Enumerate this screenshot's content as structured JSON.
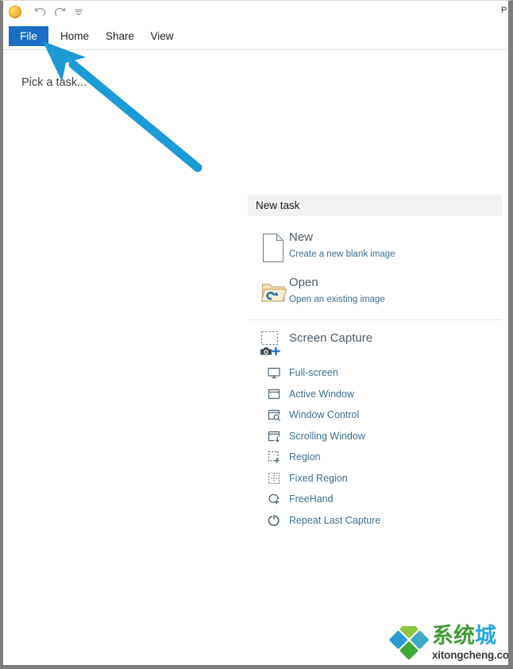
{
  "window": {
    "titlebar": {
      "app_icon": "app-logo-icon",
      "quick_access": [
        {
          "name": "undo-icon",
          "label": "Undo"
        },
        {
          "name": "redo-icon",
          "label": "Redo"
        },
        {
          "name": "customize-quick-access-icon",
          "label": "Customize Quick Access Toolbar"
        }
      ],
      "right_cut_text": "P"
    },
    "ribbon": {
      "tabs": [
        {
          "label": "File",
          "active": true
        },
        {
          "label": "Home",
          "active": false
        },
        {
          "label": "Share",
          "active": false
        },
        {
          "label": "View",
          "active": false
        }
      ]
    },
    "body": {
      "hint": "Pick a task..."
    }
  },
  "task_panel": {
    "header": "New task",
    "items": [
      {
        "icon": "new-document-icon",
        "title": "New",
        "subtitle": "Create a new blank image"
      },
      {
        "icon": "open-folder-icon",
        "title": "Open",
        "subtitle": "Open an existing image"
      }
    ],
    "screen_capture": {
      "icon": "screen-capture-icon",
      "title": "Screen Capture",
      "options": [
        {
          "icon": "monitor-icon",
          "label": "Full-screen"
        },
        {
          "icon": "window-icon",
          "label": "Active Window"
        },
        {
          "icon": "window-search-icon",
          "label": "Window Control"
        },
        {
          "icon": "scroll-window-icon",
          "label": "Scrolling Window"
        },
        {
          "icon": "region-icon",
          "label": "Region"
        },
        {
          "icon": "fixed-region-icon",
          "label": "Fixed Region"
        },
        {
          "icon": "freehand-icon",
          "label": "FreeHand"
        },
        {
          "icon": "repeat-icon",
          "label": "Repeat Last Capture"
        }
      ]
    }
  },
  "annotation": {
    "arrow": {
      "name": "pointer-arrow",
      "color": "#1c9ad6",
      "points_to": "File"
    }
  },
  "watermark": {
    "name": "site-watermark",
    "logo_icon": "four-diamonds-logo-icon",
    "text_cn_green": "系统",
    "text_cn_blue": "城",
    "domain": "xitongcheng.com",
    "colors": {
      "green": "#3f9c35",
      "blue": "#29a8df"
    }
  }
}
